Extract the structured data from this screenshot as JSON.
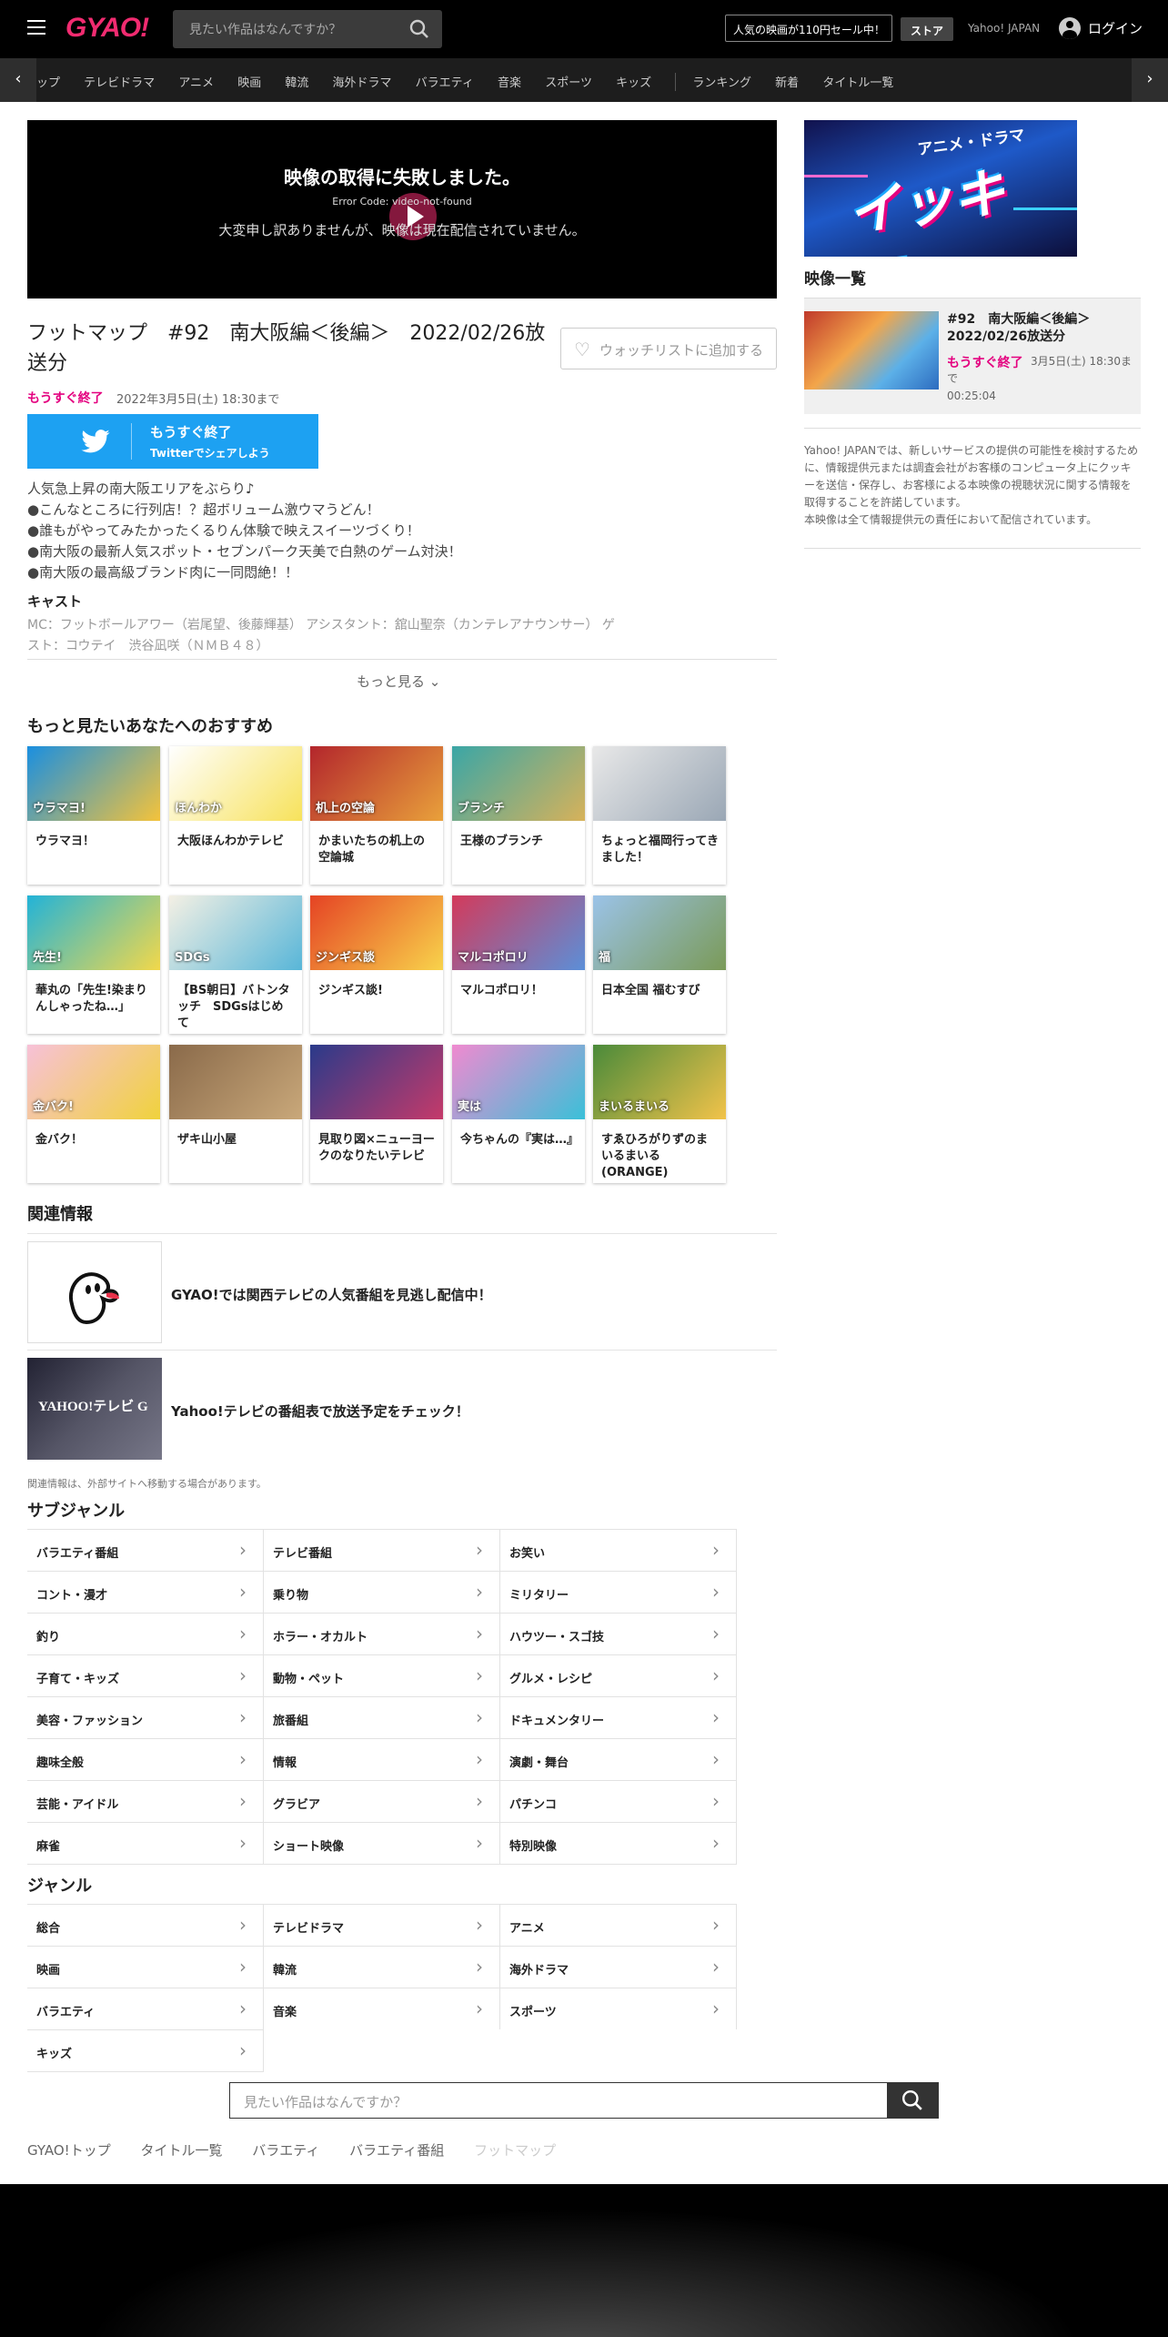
{
  "header": {
    "logo": "GYAO!",
    "search_placeholder": "見たい作品はなんですか？",
    "sale_text": "人気の映画が110円セール中！",
    "store_label": "ストア",
    "yahoo_japan": "Yahoo! JAPAN",
    "login_label": "ログイン"
  },
  "nav": {
    "items": [
      "ップ",
      "テレビドラマ",
      "アニメ",
      "映画",
      "韓流",
      "海外ドラマ",
      "バラエティ",
      "音楽",
      "スポーツ",
      "キッズ",
      "ランキング",
      "新着",
      "タイトル一覧"
    ]
  },
  "player": {
    "error_title": "映像の取得に失敗しました。",
    "error_code": "Error Code: video-not-found",
    "error_message": "大変申し訳ありませんが、映像は現在配信されていません。"
  },
  "episode": {
    "title": "フットマップ　#92　南大阪編＜後編＞　2022/02/26放送分",
    "watchlist_label": "ウォッチリストに追加する",
    "ending_soon": "もうすぐ終了",
    "end_date": "2022年3月5日(土) 18:30まで",
    "twitter_status": "もうすぐ終了",
    "twitter_share": "Twitterでシェアしよう",
    "description": [
      "人気急上昇の南大阪エリアをぶらり♪",
      "●こんなところに行列店！？超ボリューム激ウマうどん！",
      "●誰もがやってみたかったくるりん体験で映えスイーツづくり！",
      "●南大阪の最新人気スポット・セブンパーク天美で白熱のゲーム対決！",
      "●南大阪の最高級ブランド肉に一同悶絶！！"
    ],
    "cast_heading": "キャスト",
    "cast_text": "MC：フットボールアワー（岩尾望、後藤輝基） アシスタント：舘山聖奈（カンテレアナウンサー） ゲスト：コウテイ　渋谷凪咲（ＮＭＢ４８）",
    "more_label": "もっと見る"
  },
  "recommend": {
    "heading": "もっと見たいあなたへのおすすめ",
    "items": [
      {
        "title": "ウラマヨ！",
        "thumb": "ウラマヨ!",
        "c1": "#1a8fe0",
        "c2": "#f4c33b"
      },
      {
        "title": "大阪ほんわかテレビ",
        "thumb": "ほんわか",
        "c1": "#ffffff",
        "c2": "#f7e25b"
      },
      {
        "title": "かまいたちの机上の空論城",
        "thumb": "机上の空論",
        "c1": "#b3262c",
        "c2": "#e9a13b"
      },
      {
        "title": "王様のブランチ",
        "thumb": "ブランチ",
        "c1": "#3aa6a6",
        "c2": "#d7b25a"
      },
      {
        "title": "ちょっと福岡行ってきました！",
        "thumb": "",
        "c1": "#e8e8e8",
        "c2": "#9aa7b5"
      },
      {
        "title": "華丸の「先生!染まりんしゃったね…」",
        "thumb": "先生!",
        "c1": "#22b3d8",
        "c2": "#f2d84a"
      },
      {
        "title": "【BS朝日】バトンタッチ　SDGsはじめて",
        "thumb": "SDGs",
        "c1": "#f4f0e4",
        "c2": "#58b6d8"
      },
      {
        "title": "ジンギス談!",
        "thumb": "ジンギス談",
        "c1": "#e54324",
        "c2": "#f8d34b"
      },
      {
        "title": "マルコポロリ！",
        "thumb": "マルコポロリ",
        "c1": "#d33a5b",
        "c2": "#5b8fd8"
      },
      {
        "title": "日本全国 福むすび",
        "thumb": "福",
        "c1": "#9bc3e8",
        "c2": "#7a9a58"
      },
      {
        "title": "金バク！",
        "thumb": "金バク!",
        "c1": "#f7c1d8",
        "c2": "#f0d23c"
      },
      {
        "title": "ザキ山小屋",
        "thumb": "",
        "c1": "#8a6a4a",
        "c2": "#c9a87a"
      },
      {
        "title": "見取り図×ニューヨークのなりたいテレビ",
        "thumb": "",
        "c1": "#2a3a8a",
        "c2": "#c53a6a"
      },
      {
        "title": "今ちゃんの『実は…』",
        "thumb": "実は",
        "c1": "#f08ad0",
        "c2": "#3ac0d8"
      },
      {
        "title": "すゑひろがりずのまいるまいる(ORANGE)",
        "thumb": "まいるまいる",
        "c1": "#4a8a3a",
        "c2": "#f2c34a"
      }
    ]
  },
  "related": {
    "heading": "関連情報",
    "items": [
      {
        "text": "GYAO!では関西テレビの人気番組を見逃し配信中！"
      },
      {
        "text": "Yahoo!テレビの番組表で放送予定をチェック！",
        "thumb": "YAHOO!テレビ G"
      }
    ],
    "note": "関連情報は、外部サイトへ移動する場合があります。"
  },
  "subgenre": {
    "heading": "サブジャンル",
    "items": [
      "バラエティ番組",
      "テレビ番組",
      "お笑い",
      "コント・漫才",
      "乗り物",
      "ミリタリー",
      "釣り",
      "ホラー・オカルト",
      "ハウツー・スゴ技",
      "子育て・キッズ",
      "動物・ペット",
      "グルメ・レシピ",
      "美容・ファッション",
      "旅番組",
      "ドキュメンタリー",
      "趣味全般",
      "情報",
      "演劇・舞台",
      "芸能・アイドル",
      "グラビア",
      "パチンコ",
      "麻雀",
      "ショート映像",
      "特別映像"
    ]
  },
  "genre": {
    "heading": "ジャンル",
    "items": [
      "総合",
      "テレビドラマ",
      "アニメ",
      "映画",
      "韓流",
      "海外ドラマ",
      "バラエティ",
      "音楽",
      "スポーツ",
      "キッズ"
    ]
  },
  "footer_search": {
    "placeholder": "見たい作品はなんですか？"
  },
  "breadcrumbs": [
    "GYAO!トップ",
    "タイトル一覧",
    "バラエティ",
    "バラエティ番組",
    "フットマップ"
  ],
  "sidebar": {
    "banner_small": "アニメ・ドラマ",
    "banner_big": "イッキ見!",
    "list_heading": "映像一覧",
    "item_title": "#92　南大阪編＜後編＞　2022/02/26放送分",
    "item_status": "もうすぐ終了",
    "item_meta": "3月5日(土) 18:30まで",
    "item_duration": "00:25:04",
    "note": "Yahoo! JAPANでは、新しいサービスの提供の可能性を検討するために、情報提供元または調査会社がお客様のコンピュータ上にクッキーを送信・保存し、お客様による本映像の視聴状況に関する情報を取得することを許諾しています。",
    "note2": "本映像は全て情報提供元の責任において配信されています。"
  },
  "colors": {
    "accent": "#e4007f",
    "logo": "#f12b70",
    "twitter": "#1da1f2",
    "header_bg": "#000000"
  }
}
